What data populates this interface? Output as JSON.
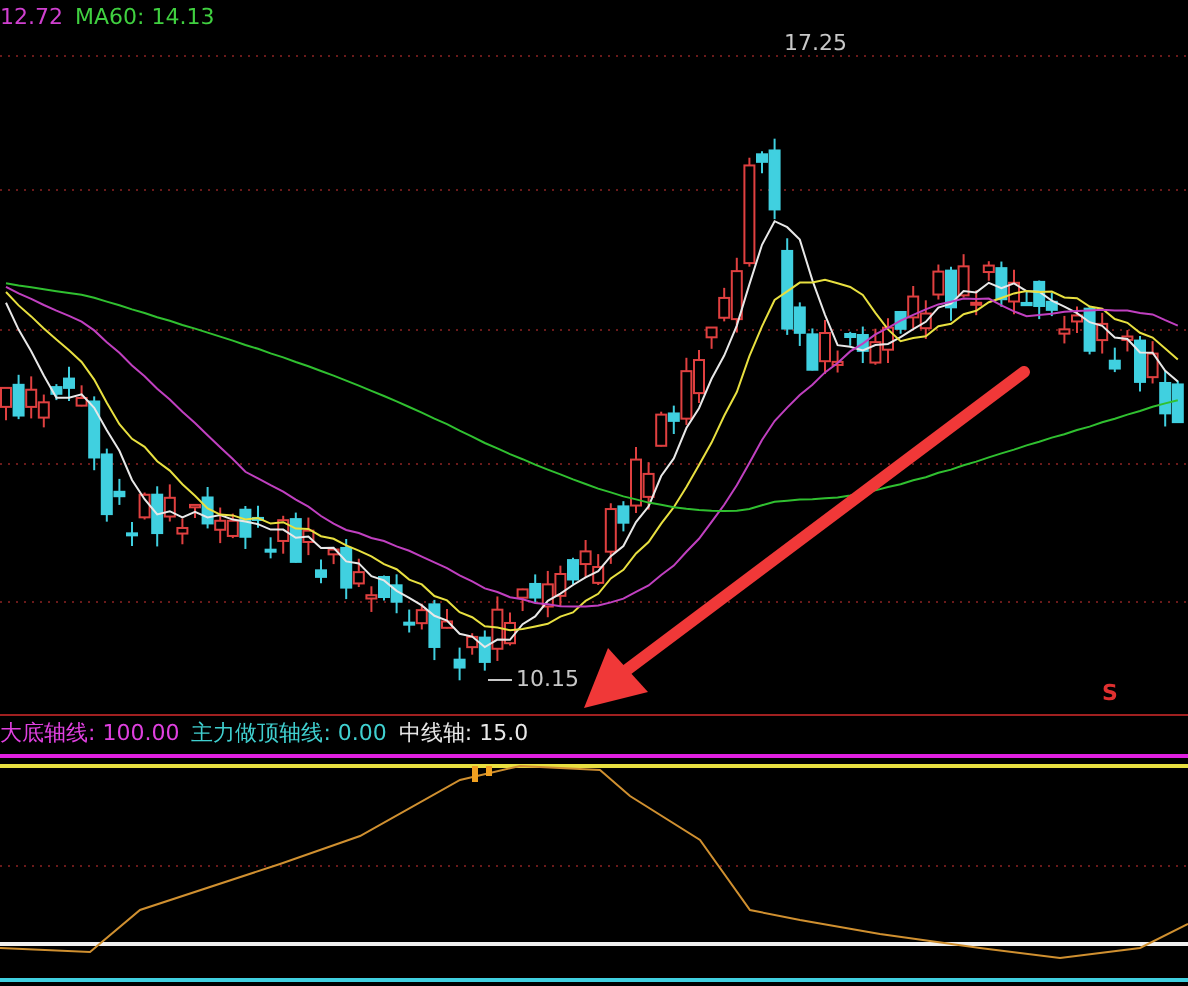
{
  "main_legend": [
    {
      "text": "12.72",
      "color": "#d040d0"
    },
    {
      "text": "MA60: 14.13",
      "color": "#40d040"
    }
  ],
  "price_labels": {
    "high": "17.25",
    "low": "10.15"
  },
  "signal": {
    "text": "S",
    "color": "#e03030"
  },
  "indicator_legend": [
    {
      "text": "大底轴线: 100.00",
      "color": "#e040e0"
    },
    {
      "text": "主力做顶轴线: 0.00",
      "color": "#40d0d0"
    },
    {
      "text": "中线轴: 15.0",
      "color": "#e8e8e8"
    }
  ]
}
